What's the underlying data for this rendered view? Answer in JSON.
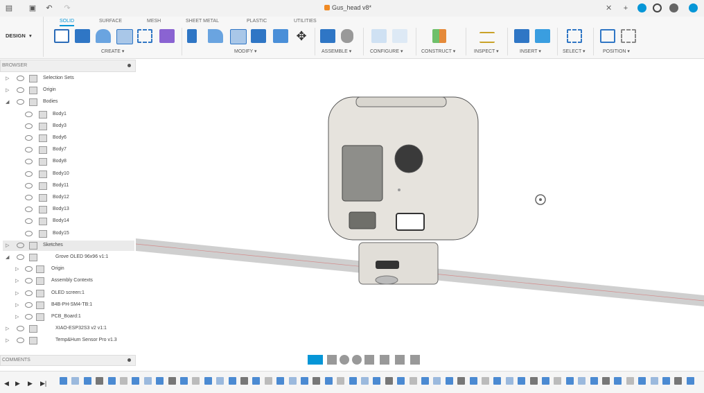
{
  "window": {
    "document_title": "Gus_head v8*"
  },
  "topbar_icons": [
    "file-icon",
    "save-icon",
    "undo-icon",
    "redo-icon",
    "close-icon",
    "plus-icon",
    "notification-icon",
    "clock-icon",
    "help-icon"
  ],
  "workspace": {
    "label": "DESIGN"
  },
  "tabs": [
    {
      "label": "SOLID",
      "active": true
    },
    {
      "label": "SURFACE",
      "active": false
    },
    {
      "label": "MESH",
      "active": false
    },
    {
      "label": "SHEET METAL",
      "active": false
    },
    {
      "label": "PLASTIC",
      "active": false
    },
    {
      "label": "UTILITIES",
      "active": false
    }
  ],
  "groups": [
    {
      "label": "CREATE"
    },
    {
      "label": "MODIFY"
    },
    {
      "label": "ASSEMBLE"
    },
    {
      "label": "CONFIGURE"
    },
    {
      "label": "CONSTRUCT"
    },
    {
      "label": "INSPECT"
    },
    {
      "label": "INSERT"
    },
    {
      "label": "SELECT"
    },
    {
      "label": "POSITION"
    }
  ],
  "browser": {
    "title": "BROWSER",
    "items": [
      {
        "label": "Selection Sets"
      },
      {
        "label": "Origin"
      },
      {
        "label": "Bodies"
      },
      {
        "label": "Body1"
      },
      {
        "label": "Body3"
      },
      {
        "label": "Body6"
      },
      {
        "label": "Body7"
      },
      {
        "label": "Body8"
      },
      {
        "label": "Body10"
      },
      {
        "label": "Body11"
      },
      {
        "label": "Body12"
      },
      {
        "label": "Body13"
      },
      {
        "label": "Body14"
      },
      {
        "label": "Body15"
      },
      {
        "label": "Sketches"
      },
      {
        "label": "Grove OLED 96x96 v1:1"
      },
      {
        "label": "Origin"
      },
      {
        "label": "Assembly Contexts"
      },
      {
        "label": "OLED screen:1"
      },
      {
        "label": "B4B-PH-SM4-TB:1"
      },
      {
        "label": "PCB_Board:1"
      },
      {
        "label": "XIAO-ESP32S3 v2 v1:1"
      },
      {
        "label": "Temp&Hum Sensor Pro v1.3"
      }
    ]
  },
  "comments": {
    "title": "COMMENTS"
  },
  "colors": {
    "accent": "#0696d7",
    "body_fill": "#e4e1db",
    "ground_plane": "#c8c8c8"
  }
}
